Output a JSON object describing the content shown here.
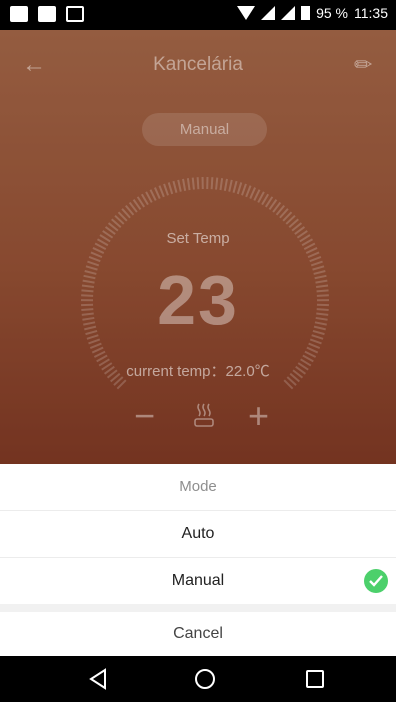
{
  "status_bar": {
    "icons_left": [
      "youtube-icon",
      "gallery-icon",
      "robot-icon"
    ],
    "battery": "95 %",
    "time": "11:35"
  },
  "header": {
    "back_icon": "arrow-left-icon",
    "title": "Kancelária",
    "edit_icon": "pencil-icon"
  },
  "thermostat": {
    "mode_label": "Manual",
    "set_temp_label": "Set Temp",
    "set_temp_value": "23",
    "current_temp_text": "current temp：22.0℃",
    "minus_label": "−",
    "plus_label": "+",
    "heat_icon": "heating-icon"
  },
  "mode_sheet": {
    "title": "Mode",
    "options": [
      "Auto",
      "Manual"
    ],
    "selected": "Manual",
    "cancel": "Cancel",
    "check_color": "#4cd06b"
  },
  "nav_bar": {
    "buttons": [
      "back-icon",
      "home-icon",
      "recents-icon"
    ]
  }
}
